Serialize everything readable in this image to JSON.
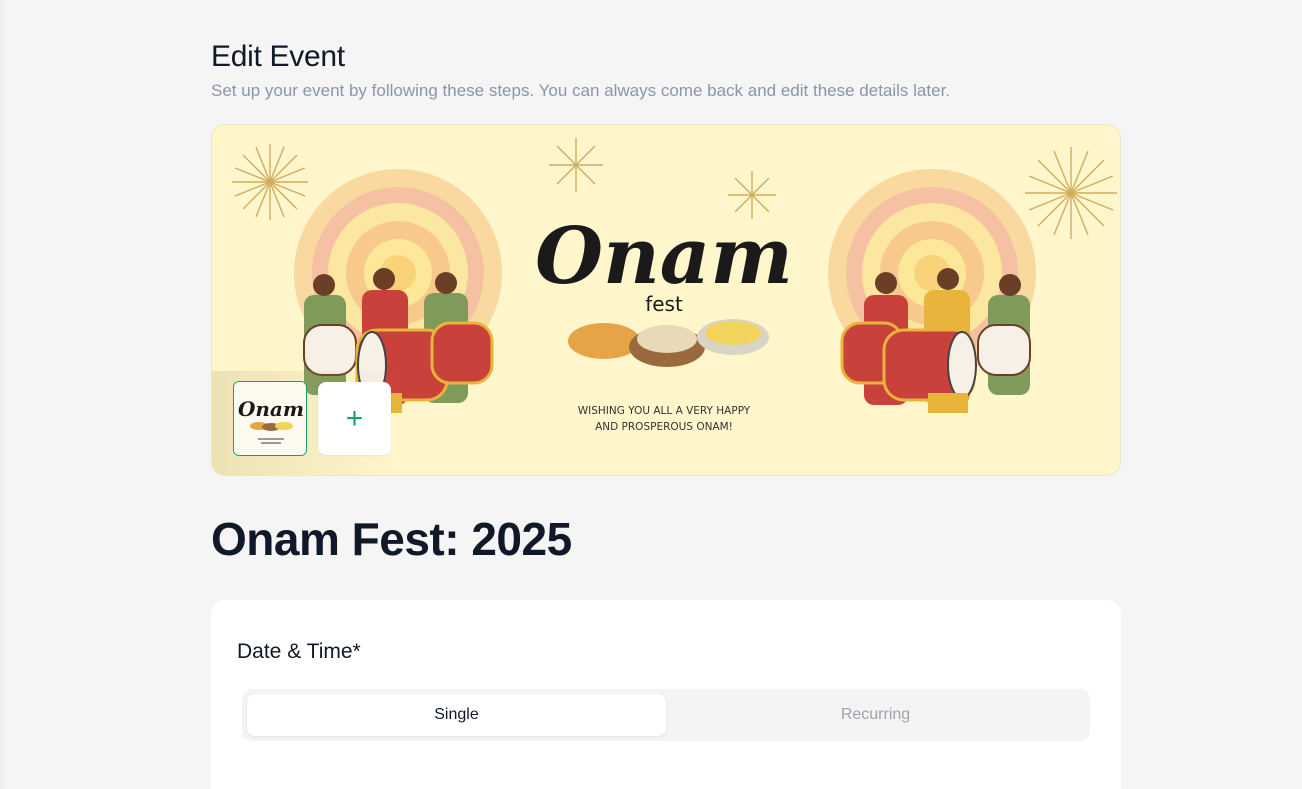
{
  "header": {
    "title": "Edit Event",
    "subtitle": "Set up your event by following these steps. You can always come back and edit these details later."
  },
  "banner": {
    "headline": "Onam",
    "subheadline": "fest",
    "message_line1": "WISHING YOU ALL A VERY HAPPY",
    "message_line2": "AND PROSPEROUS ONAM!",
    "thumbnail_headline": "Onam",
    "add_icon": "plus-icon"
  },
  "event": {
    "title": "Onam Fest: 2025"
  },
  "date_time": {
    "label": "Date & Time*",
    "options": [
      "Single",
      "Recurring"
    ],
    "selected": "Single"
  },
  "colors": {
    "accent": "#16a37a",
    "banner_bg": "#fff6cc",
    "page_bg": "#f5f5f5"
  }
}
